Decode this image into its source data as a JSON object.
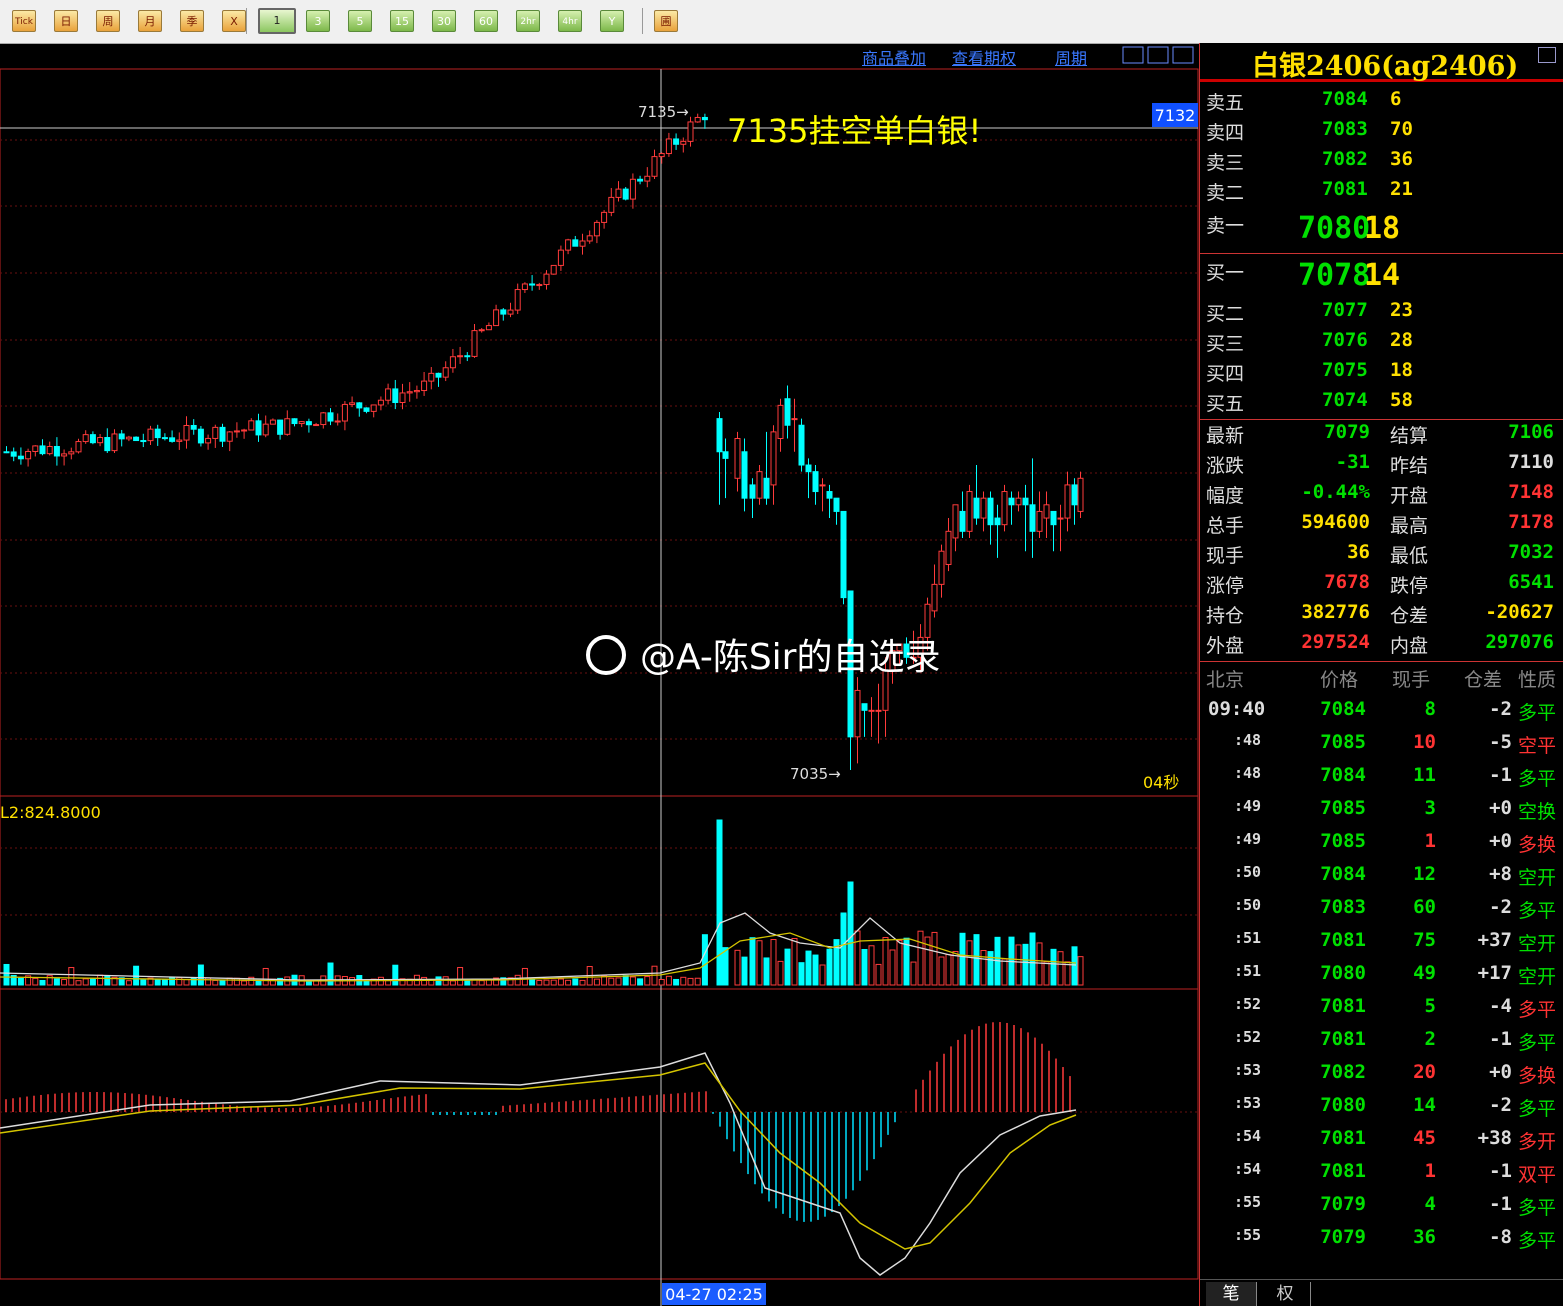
{
  "toolbar": {
    "buttons": [
      "Tick",
      "日",
      "周",
      "月",
      "季",
      "X",
      "1",
      "3",
      "5",
      "15",
      "30",
      "60",
      "2hr",
      "4hr",
      "Y",
      "圃"
    ],
    "selected": "1"
  },
  "chart": {
    "top_links": [
      "商品叠加",
      "查看期权",
      "周期"
    ],
    "price_tag": "7132",
    "high_label": "7135",
    "low_label": "7035",
    "annotation": "7135挂空单白银!",
    "seconds_label": "04秒",
    "volume_label": "L2:824.8000",
    "cursor_time": "04-27 02:25",
    "watermark": "@A-陈Sir的自选录"
  },
  "panel": {
    "title": "白银2406(ag2406)",
    "asks": [
      {
        "label": "卖五",
        "price": "7084",
        "qty": "6"
      },
      {
        "label": "卖四",
        "price": "7083",
        "qty": "70"
      },
      {
        "label": "卖三",
        "price": "7082",
        "qty": "36"
      },
      {
        "label": "卖二",
        "price": "7081",
        "qty": "21"
      },
      {
        "label": "卖一",
        "price": "7080",
        "qty": "18"
      }
    ],
    "bids": [
      {
        "label": "买一",
        "price": "7078",
        "qty": "14"
      },
      {
        "label": "买二",
        "price": "7077",
        "qty": "23"
      },
      {
        "label": "买三",
        "price": "7076",
        "qty": "28"
      },
      {
        "label": "买四",
        "price": "7075",
        "qty": "18"
      },
      {
        "label": "买五",
        "price": "7074",
        "qty": "58"
      }
    ],
    "stats": [
      {
        "l1": "最新",
        "v1": "7079",
        "c1": "g",
        "l2": "结算",
        "v2": "7106",
        "c2": "g"
      },
      {
        "l1": "涨跌",
        "v1": "-31",
        "c1": "g",
        "l2": "昨结",
        "v2": "7110",
        "c2": "w"
      },
      {
        "l1": "幅度",
        "v1": "-0.44%",
        "c1": "g",
        "l2": "开盘",
        "v2": "7148",
        "c2": "r"
      },
      {
        "l1": "总手",
        "v1": "594600",
        "c1": "y",
        "l2": "最高",
        "v2": "7178",
        "c2": "r"
      },
      {
        "l1": "现手",
        "v1": "36",
        "c1": "y",
        "l2": "最低",
        "v2": "7032",
        "c2": "g"
      },
      {
        "l1": "涨停",
        "v1": "7678",
        "c1": "r",
        "l2": "跌停",
        "v2": "6541",
        "c2": "g"
      },
      {
        "l1": "持仓",
        "v1": "382776",
        "c1": "y",
        "l2": "仓差",
        "v2": "-20627",
        "c2": "y"
      },
      {
        "l1": "外盘",
        "v1": "297524",
        "c1": "r",
        "l2": "内盘",
        "v2": "297076",
        "c2": "g"
      }
    ],
    "trade_headers": [
      "北京",
      "价格",
      "现手",
      "仓差",
      "性质"
    ],
    "trades": [
      {
        "t": "09:40",
        "p": "7084",
        "q": "8",
        "qc": "g",
        "d": "-2",
        "n": "多平",
        "nc": "g"
      },
      {
        "t": ":48",
        "p": "7085",
        "q": "10",
        "qc": "r",
        "d": "-5",
        "n": "空平",
        "nc": "r"
      },
      {
        "t": ":48",
        "p": "7084",
        "q": "11",
        "qc": "g",
        "d": "-1",
        "n": "多平",
        "nc": "g"
      },
      {
        "t": ":49",
        "p": "7085",
        "q": "3",
        "qc": "g",
        "d": "+0",
        "n": "空换",
        "nc": "g"
      },
      {
        "t": ":49",
        "p": "7085",
        "q": "1",
        "qc": "r",
        "d": "+0",
        "n": "多换",
        "nc": "r"
      },
      {
        "t": ":50",
        "p": "7084",
        "q": "12",
        "qc": "g",
        "d": "+8",
        "n": "空开",
        "nc": "g"
      },
      {
        "t": ":50",
        "p": "7083",
        "q": "60",
        "qc": "g",
        "d": "-2",
        "n": "多平",
        "nc": "g"
      },
      {
        "t": ":51",
        "p": "7081",
        "q": "75",
        "qc": "g",
        "d": "+37",
        "n": "空开",
        "nc": "g"
      },
      {
        "t": ":51",
        "p": "7080",
        "q": "49",
        "qc": "g",
        "d": "+17",
        "n": "空开",
        "nc": "g"
      },
      {
        "t": ":52",
        "p": "7081",
        "q": "5",
        "qc": "g",
        "d": "-4",
        "n": "多平",
        "nc": "r"
      },
      {
        "t": ":52",
        "p": "7081",
        "q": "2",
        "qc": "g",
        "d": "-1",
        "n": "多平",
        "nc": "g"
      },
      {
        "t": ":53",
        "p": "7082",
        "q": "20",
        "qc": "r",
        "d": "+0",
        "n": "多换",
        "nc": "r"
      },
      {
        "t": ":53",
        "p": "7080",
        "q": "14",
        "qc": "g",
        "d": "-2",
        "n": "多平",
        "nc": "g"
      },
      {
        "t": ":54",
        "p": "7081",
        "q": "45",
        "qc": "r",
        "d": "+38",
        "n": "多开",
        "nc": "r"
      },
      {
        "t": ":54",
        "p": "7081",
        "q": "1",
        "qc": "r",
        "d": "-1",
        "n": "双平",
        "nc": "r"
      },
      {
        "t": ":55",
        "p": "7079",
        "q": "4",
        "qc": "g",
        "d": "-1",
        "n": "多平",
        "nc": "g"
      },
      {
        "t": ":55",
        "p": "7079",
        "q": "36",
        "qc": "g",
        "d": "-8",
        "n": "多平",
        "nc": "g"
      }
    ],
    "tabs": [
      "笔",
      "权"
    ]
  }
}
